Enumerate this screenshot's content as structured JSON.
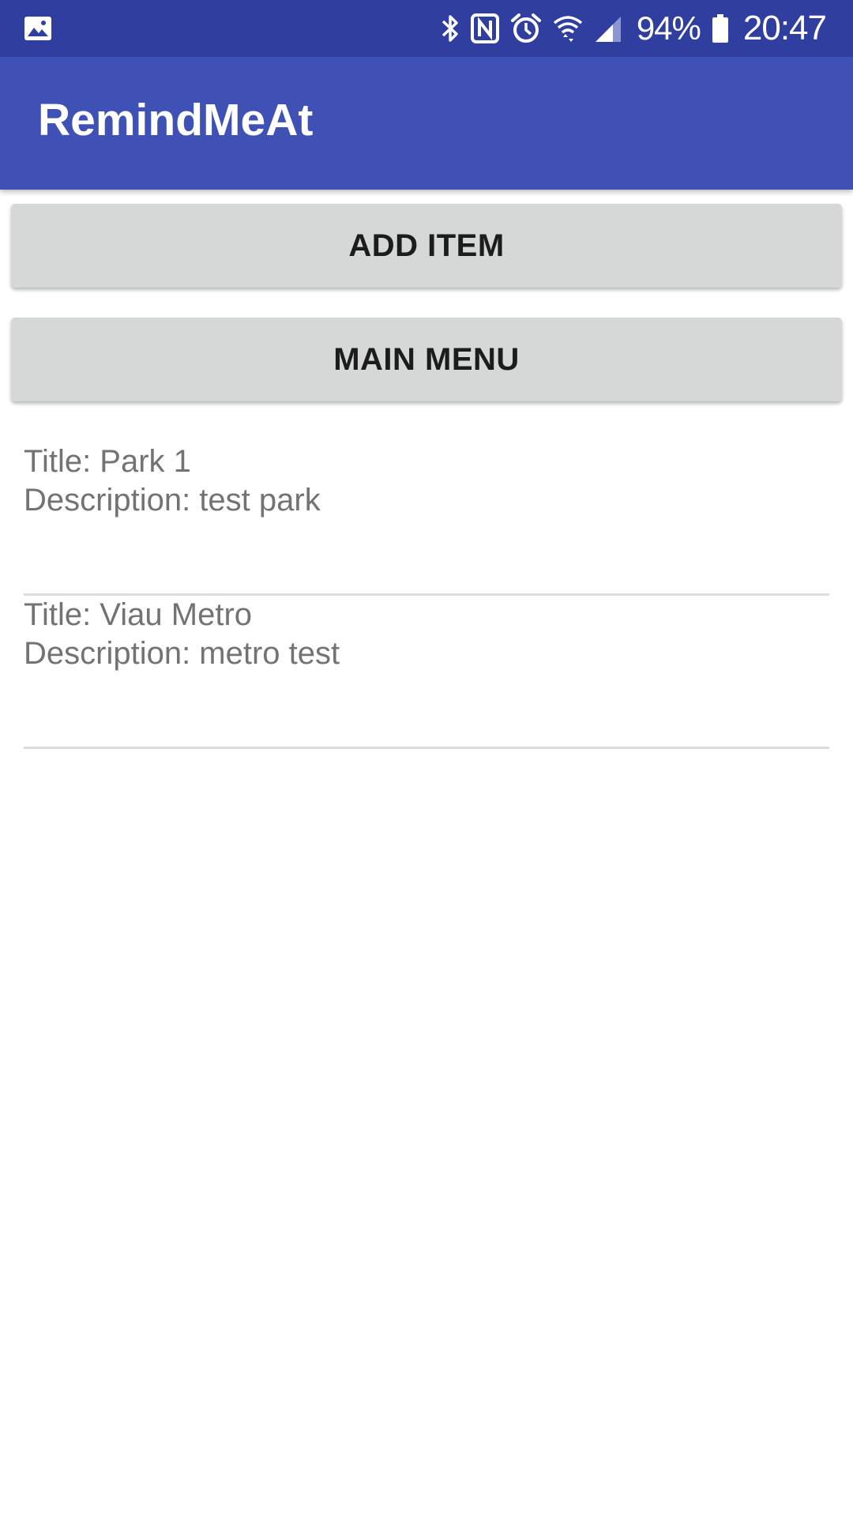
{
  "status_bar": {
    "battery_percent": "94%",
    "time": "20:47",
    "icons": [
      "gallery-icon",
      "bluetooth-icon",
      "nfc-icon",
      "alarm-icon",
      "wifi-icon",
      "signal-icon",
      "battery-icon"
    ]
  },
  "app_bar": {
    "title": "RemindMeAt"
  },
  "buttons": {
    "add_item": "ADD ITEM",
    "main_menu": "MAIN MENU"
  },
  "items": [
    {
      "title": "Title: Park 1",
      "description": "Description: test park"
    },
    {
      "title": "Title: Viau Metro",
      "description": "Description: metro test"
    }
  ],
  "colors": {
    "status_bar": "#303F9F",
    "app_bar": "#3F51B5",
    "button": "#D6D7D7",
    "item_text": "#737373"
  }
}
